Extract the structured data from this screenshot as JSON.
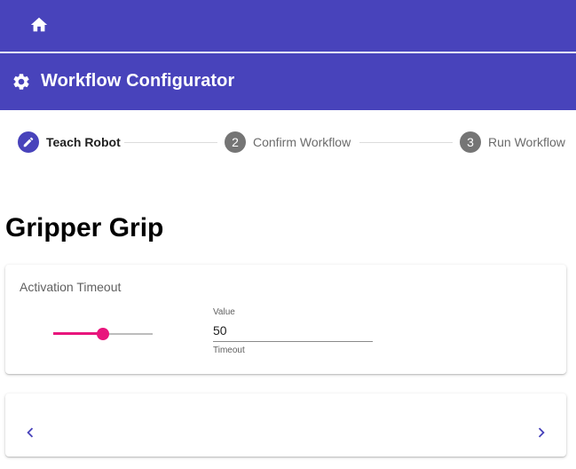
{
  "topbar": {
    "home_icon": "home-icon"
  },
  "header": {
    "title": "Workflow Configurator",
    "icon": "gear-icon"
  },
  "stepper": {
    "steps": [
      {
        "label": "Teach Robot",
        "number": "",
        "icon": "pencil-icon",
        "state": "active"
      },
      {
        "label": "Confirm Workflow",
        "number": "2",
        "state": "inactive"
      },
      {
        "label": "Run Workflow",
        "number": "3",
        "state": "inactive"
      }
    ]
  },
  "page": {
    "heading": "Gripper Grip"
  },
  "activation": {
    "title": "Activation Timeout",
    "slider_fraction": 0.5,
    "field": {
      "label": "Value",
      "value": "50",
      "helper": "Timeout"
    }
  },
  "navigation": {
    "prev_icon": "chevron-left-icon",
    "next_icon": "chevron-right-icon"
  },
  "colors": {
    "primary": "#4843bb",
    "accent": "#e8157c",
    "inactive_step": "#757575"
  }
}
